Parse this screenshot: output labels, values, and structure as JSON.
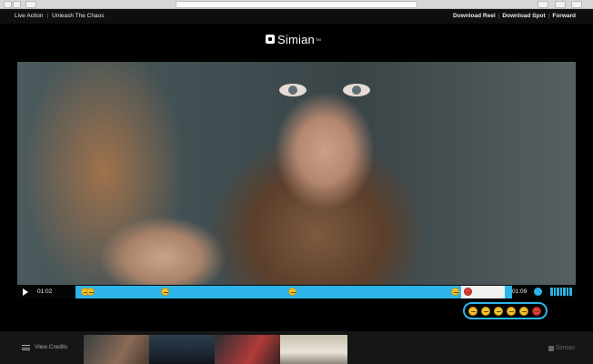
{
  "header": {
    "breadcrumb": [
      "Live Action",
      "Unleash The Chaos"
    ],
    "actions": [
      "Download Reel",
      "Download Spot",
      "Forward"
    ]
  },
  "logo": {
    "text": "Simian",
    "tm": "TM"
  },
  "player": {
    "current_time": "01:02",
    "duration": "01:09",
    "progress": 0.9,
    "reaction_markers": [
      {
        "icon": "smile-emoji-icon",
        "color": "#f2c230"
      },
      {
        "icon": "grin-emoji-icon",
        "color": "#f2c230"
      },
      {
        "icon": "neutral-emoji-icon",
        "color": "#f2c230"
      },
      {
        "icon": "grin-emoji-icon",
        "color": "#f2c230"
      },
      {
        "icon": "smile-emoji-icon",
        "color": "#f2c230"
      },
      {
        "icon": "angry-emoji-icon",
        "color": "#e33b3b"
      }
    ]
  },
  "reaction_picker": [
    {
      "icon": "love-emoji-icon"
    },
    {
      "icon": "happy-emoji-icon"
    },
    {
      "icon": "neutral-emoji-icon"
    },
    {
      "icon": "meh-emoji-icon"
    },
    {
      "icon": "sad-emoji-icon"
    },
    {
      "icon": "angry-emoji-icon"
    }
  ],
  "footer": {
    "credits_label": "View Credits",
    "brand": "Simian",
    "thumbnails": [
      "thumbnail-1",
      "thumbnail-2",
      "thumbnail-3",
      "thumbnail-4"
    ]
  },
  "colors": {
    "accent": "#2db4e8",
    "background": "#000000"
  }
}
